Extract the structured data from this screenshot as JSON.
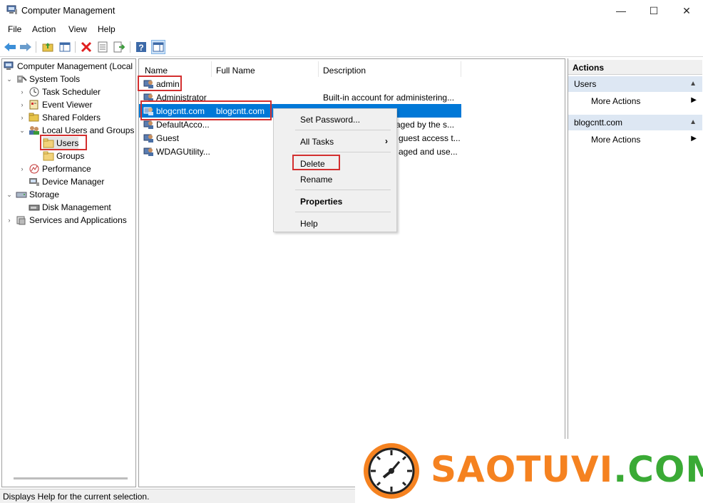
{
  "window": {
    "title": "Computer Management",
    "minimize_glyph": "—",
    "maximize_glyph": "☐",
    "close_glyph": "✕"
  },
  "menu": [
    "File",
    "Action",
    "View",
    "Help"
  ],
  "toolbar": {
    "icons": [
      "back-arrow-icon",
      "forward-arrow-icon",
      "up-folder-icon",
      "show-hide-tree-icon",
      "delete-icon",
      "properties-icon",
      "export-list-icon",
      "help-icon",
      "action-pane-icon"
    ]
  },
  "tree": {
    "root": "Computer Management (Local",
    "system_tools": "System Tools",
    "task_scheduler": "Task Scheduler",
    "event_viewer": "Event Viewer",
    "shared_folders": "Shared Folders",
    "local_users_groups": "Local Users and Groups",
    "users": "Users",
    "groups": "Groups",
    "performance": "Performance",
    "device_manager": "Device Manager",
    "storage": "Storage",
    "disk_management": "Disk Management",
    "services_apps": "Services and Applications"
  },
  "list": {
    "columns": [
      "Name",
      "Full Name",
      "Description"
    ],
    "rows": [
      {
        "name": "admin",
        "fullname": "",
        "desc": ""
      },
      {
        "name": "Administrator",
        "fullname": "",
        "desc": "Built-in account for administering..."
      },
      {
        "name": "blogcntt.com",
        "fullname": "blogcntt.com",
        "desc": ""
      },
      {
        "name": "DefaultAcco...",
        "fullname": "",
        "desc": "aged by the s..."
      },
      {
        "name": "Guest",
        "fullname": "",
        "desc": "guest access t..."
      },
      {
        "name": "WDAGUtility...",
        "fullname": "",
        "desc": "aged and use..."
      }
    ]
  },
  "context_menu": {
    "set_password": "Set Password...",
    "all_tasks": "All Tasks",
    "delete": "Delete",
    "rename": "Rename",
    "properties": "Properties",
    "help": "Help",
    "submenu_arrow": "›"
  },
  "actions": {
    "title": "Actions",
    "sections": [
      {
        "label": "Users",
        "item": "More Actions"
      },
      {
        "label": "blogcntt.com",
        "item": "More Actions"
      }
    ]
  },
  "status": {
    "text": "Displays Help for the current selection."
  },
  "watermark": {
    "part1": "SAOTUVI",
    "part2": ".COM"
  },
  "colors": {
    "selection": "#0078d7",
    "highlight_box": "#d32f2f",
    "brand_orange": "#f58220",
    "brand_green": "#3aaa35"
  }
}
